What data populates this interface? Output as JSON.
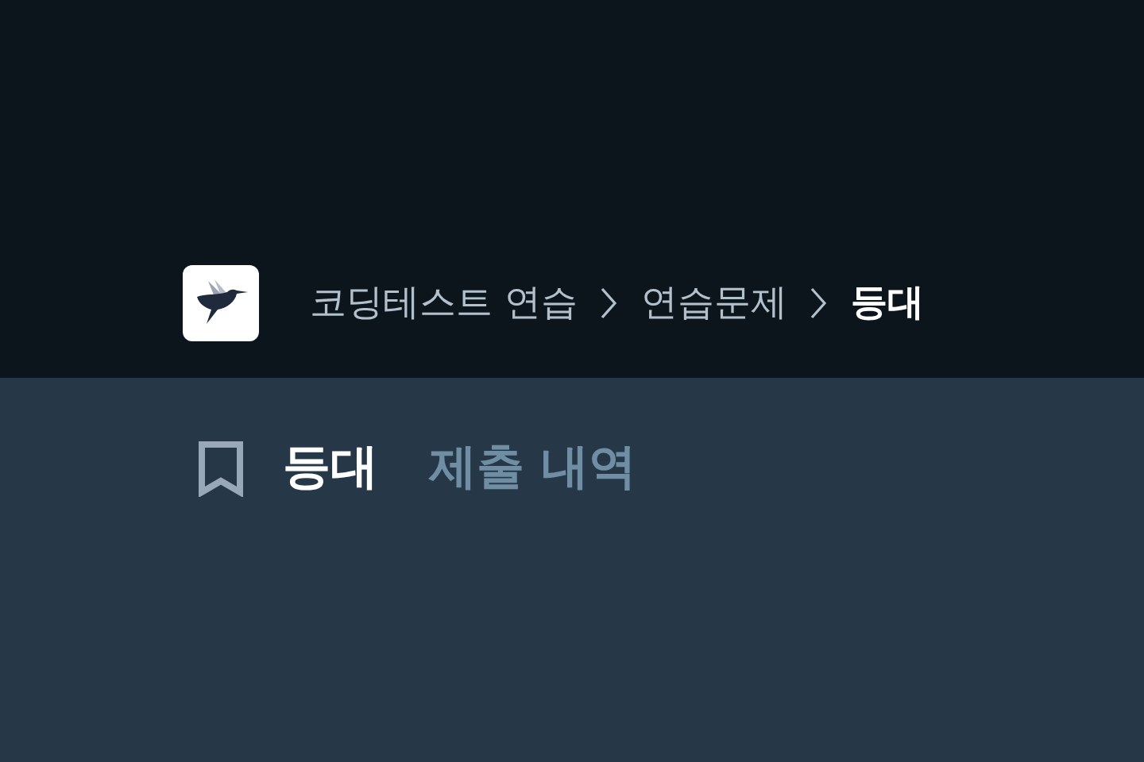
{
  "breadcrumb": [
    {
      "label": "코딩테스트 연습",
      "current": false
    },
    {
      "label": "연습문제",
      "current": false
    },
    {
      "label": "등대",
      "current": true
    }
  ],
  "tabs": [
    {
      "label": "등대",
      "selected": true
    },
    {
      "label": "제출 내역",
      "selected": false
    }
  ]
}
